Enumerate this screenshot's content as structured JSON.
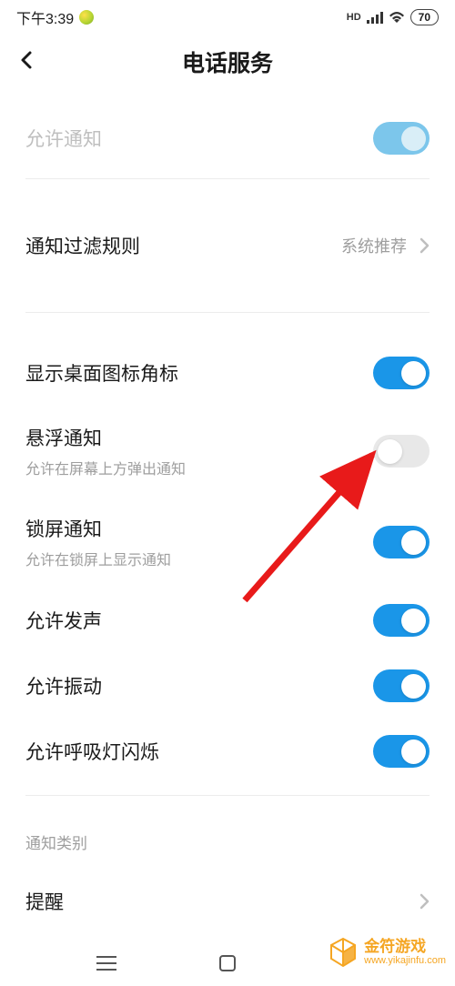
{
  "status_bar": {
    "time": "下午3:39",
    "hd_label": "HD",
    "battery_level": "70"
  },
  "header": {
    "title": "电话服务"
  },
  "items": {
    "allow_notify": {
      "title": "允许通知",
      "state": "on-disabled"
    },
    "filter_rule": {
      "title": "通知过滤规则",
      "value": "系统推荐"
    },
    "badge": {
      "title": "显示桌面图标角标",
      "state": "on"
    },
    "floating": {
      "title": "悬浮通知",
      "subtitle": "允许在屏幕上方弹出通知",
      "state": "off"
    },
    "lockscreen": {
      "title": "锁屏通知",
      "subtitle": "允许在锁屏上显示通知",
      "state": "on"
    },
    "sound": {
      "title": "允许发声",
      "state": "on"
    },
    "vibrate": {
      "title": "允许振动",
      "state": "on"
    },
    "led": {
      "title": "允许呼吸灯闪烁",
      "state": "on"
    }
  },
  "section": {
    "category_label": "通知类别",
    "reminder": {
      "title": "提醒"
    }
  },
  "watermark": {
    "title": "金符游戏",
    "url": "www.yikajinfu.com"
  }
}
